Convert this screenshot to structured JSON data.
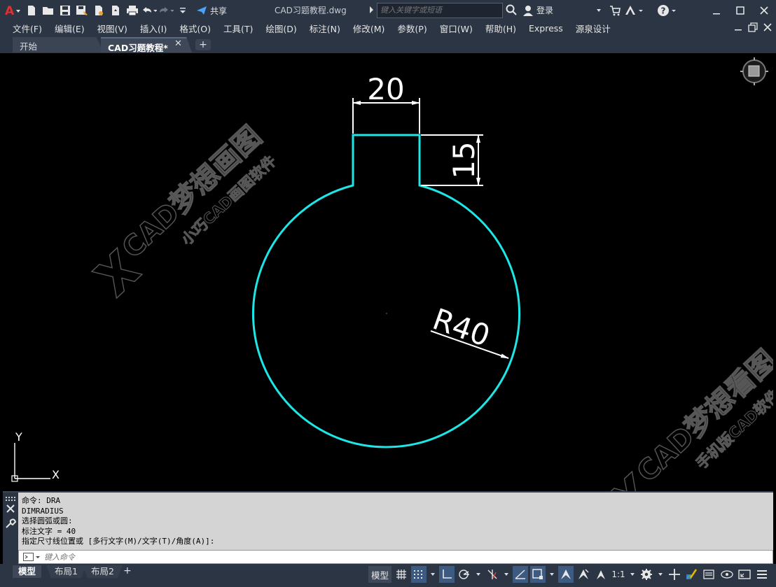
{
  "titlebar": {
    "share_label": "共享",
    "document_title": "CAD习题教程.dwg",
    "search_placeholder": "键入关键字或短语",
    "login_label": "登录"
  },
  "menu": {
    "items": [
      "文件(F)",
      "编辑(E)",
      "视图(V)",
      "插入(I)",
      "格式(O)",
      "工具(T)",
      "绘图(D)",
      "标注(N)",
      "修改(M)",
      "参数(P)",
      "窗口(W)",
      "帮助(H)",
      "Express",
      "源泉设计"
    ]
  },
  "tabs": {
    "start": "开始",
    "document": "CAD习题教程*"
  },
  "drawing": {
    "dim_width": "20",
    "dim_height": "15",
    "dim_radius": "R40",
    "ucs_y": "Y",
    "ucs_x": "X",
    "watermark1_main": "CAD梦想画图",
    "watermark1_sub": "小巧CAD画图软件",
    "watermark2_main": "CAD梦想看图",
    "watermark2_sub": "手机版CAD软件",
    "shape_color": "#1ee6e6",
    "dimension_color": "#ffffff"
  },
  "command": {
    "history": [
      "命令: DRA",
      "DIMRADIUS",
      "选择圆弧或圆:",
      "标注文字 = 40",
      "指定尺寸线位置或 [多行文字(M)/文字(T)/角度(A)]:"
    ],
    "placeholder": "键入命令"
  },
  "status": {
    "layout_tabs": [
      "模型",
      "布局1",
      "布局2"
    ],
    "model_button": "模型",
    "scale": "1:1"
  }
}
